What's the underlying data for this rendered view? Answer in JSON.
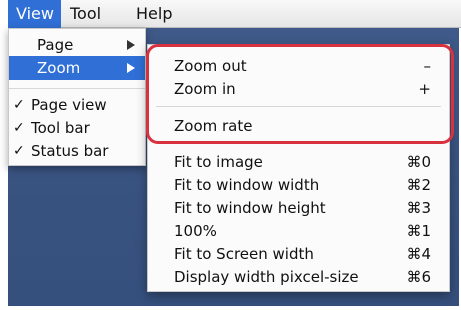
{
  "menubar": {
    "view": "View",
    "tool": "Tool",
    "help": "Help"
  },
  "view_menu": {
    "page": "Page",
    "zoom": "Zoom",
    "toggles": [
      {
        "check": "✓",
        "label": "Page view"
      },
      {
        "check": "✓",
        "label": "Tool bar"
      },
      {
        "check": "✓",
        "label": "Status bar"
      }
    ]
  },
  "zoom_submenu": {
    "zoom_out": {
      "label": "Zoom out",
      "shortcut": "–"
    },
    "zoom_in": {
      "label": "Zoom in",
      "shortcut": "+"
    },
    "zoom_rate": {
      "label": "Zoom rate"
    },
    "fit_items": [
      {
        "label": "Fit to image",
        "shortcut": "⌘0"
      },
      {
        "label": "Fit to window width",
        "shortcut": "⌘2"
      },
      {
        "label": "Fit to window height",
        "shortcut": "⌘3"
      },
      {
        "label": "100%",
        "shortcut": "⌘1"
      },
      {
        "label": "Fit to Screen width",
        "shortcut": "⌘4"
      },
      {
        "label": "Display width pixcel-size",
        "shortcut": "⌘6"
      }
    ]
  },
  "colors": {
    "highlight_border": "#d8323f",
    "selection": "#2f6fd6",
    "desktop": "#3a5582"
  }
}
